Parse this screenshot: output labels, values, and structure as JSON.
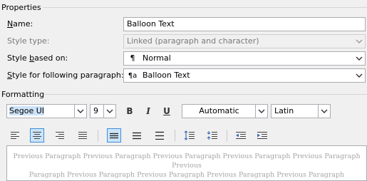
{
  "properties": {
    "group_title": "Properties",
    "name": {
      "label": "Name:",
      "value": "Balloon Text"
    },
    "style_type": {
      "label": "Style type:",
      "value": "Linked (paragraph and character)"
    },
    "based_on": {
      "label_pre": "Style ",
      "label_key": "b",
      "label_post": "ased on:",
      "value": "Normal",
      "icon": "paragraph-mark-icon"
    },
    "following": {
      "label_pre": "",
      "label_key": "S",
      "label_post": "tyle for following paragraph:",
      "value": "Balloon Text",
      "icon": "linked-style-icon"
    }
  },
  "formatting": {
    "group_title": "Formatting",
    "font": "Segoe UI",
    "size": "9",
    "bold": "B",
    "italic": "I",
    "underline": "U",
    "color": "Automatic",
    "script": "Latin",
    "alignment": "center",
    "line_spacing": "single"
  },
  "preview": {
    "line1": "Previous Paragraph Previous Paragraph Previous Paragraph Previous Paragraph Previous Paragraph Previous",
    "line2": "Paragraph Previous Paragraph Previous Paragraph Previous Paragraph Previous Paragraph"
  }
}
